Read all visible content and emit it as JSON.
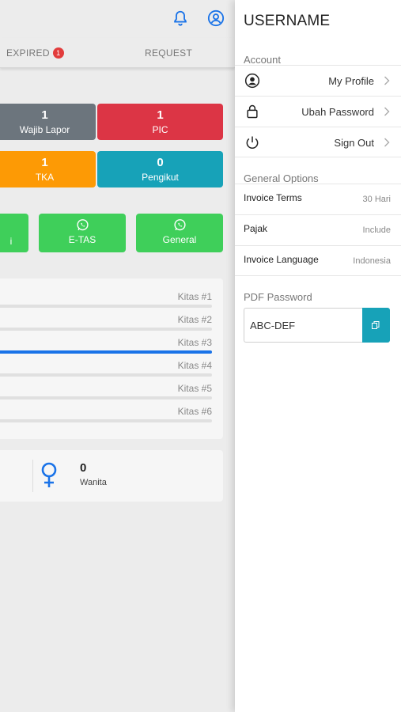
{
  "header": {
    "tabs": [
      {
        "label": "EXPIRED",
        "badge": "1"
      },
      {
        "label": "REQUEST"
      }
    ]
  },
  "stats": [
    {
      "value": "1",
      "label": "Wajib Lapor",
      "color": "#6c757d"
    },
    {
      "value": "1",
      "label": "PIC",
      "color": "#dc3545"
    },
    {
      "value": "1",
      "label": "TKA",
      "color": "#fd9a05"
    },
    {
      "value": "0",
      "label": "Pengikut",
      "color": "#17a2b8"
    }
  ],
  "whatsapp_buttons": [
    {
      "label": "i"
    },
    {
      "label": "E-TAS"
    },
    {
      "label": "General"
    }
  ],
  "kitas": [
    {
      "label": "Kitas #1",
      "progress": 0
    },
    {
      "label": "Kitas #2",
      "progress": 0
    },
    {
      "label": "Kitas #3",
      "progress": 1.0
    },
    {
      "label": "Kitas #4",
      "progress": 0
    },
    {
      "label": "Kitas #5",
      "progress": 0
    },
    {
      "label": "Kitas #6",
      "progress": 0
    }
  ],
  "gender": {
    "value": "0",
    "label": "Wanita"
  },
  "drawer": {
    "title": "USERNAME",
    "account_section": "Account",
    "account_items": [
      {
        "label": "My Profile",
        "icon": "user-circle-icon"
      },
      {
        "label": "Ubah Password",
        "icon": "lock-icon"
      },
      {
        "label": "Sign Out",
        "icon": "power-icon"
      }
    ],
    "general_section": "General Options",
    "options": [
      {
        "label": "Invoice Terms",
        "value": "30 Hari"
      },
      {
        "label": "Pajak",
        "value": "Include"
      },
      {
        "label": "Invoice Language",
        "value": "Indonesia"
      }
    ],
    "pdf_section": "PDF Password",
    "pdf_password": "ABC-DEF"
  },
  "colors": {
    "accent_blue": "#1a73e8",
    "whatsapp_green": "#3fcf5a",
    "teal": "#17a2b8"
  }
}
